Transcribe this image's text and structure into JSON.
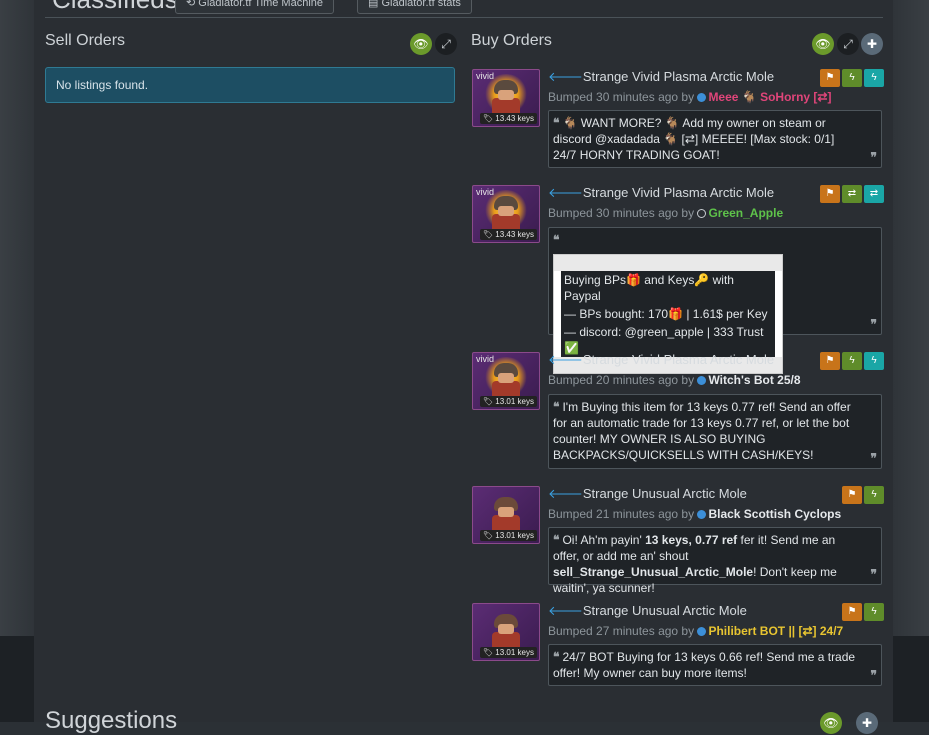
{
  "header": {
    "title": "Classifieds",
    "btn1": "Gladiator.tf Time Machine",
    "btn2": "Gladiator.tf stats"
  },
  "sell": {
    "title": "Sell Orders",
    "empty": "No listings found.",
    "icons": [
      "eye-icon",
      "expand-icon"
    ]
  },
  "buy": {
    "title": "Buy Orders",
    "icons": [
      "eye-icon",
      "expand-icon",
      "plus-icon"
    ]
  },
  "orders": [
    {
      "quality": "vivid",
      "price": "13.43 keys",
      "name": "Strange Vivid Plasma Arctic Mole",
      "bump": "Bumped 30 minutes ago by",
      "user": "Meee 🐐 SoHorny [⇄]",
      "userColor": "#e0457a",
      "status": "dot",
      "msg": "🐐 WANT MORE? 🐐 Add my owner on steam or discord @xadadada 🐐 [⇄] MEEEE! [Max stock: 0/1] 24/7 HORNY TRADING GOAT!",
      "actions": [
        "flag",
        "bolt",
        "bolt"
      ]
    },
    {
      "quality": "vivid",
      "price": "13.43 keys",
      "name": "Strange Vivid Plasma Arctic Mole",
      "bump": "Bumped 30 minutes ago by",
      "user": "Green_Apple",
      "userColor": "#5ec24a",
      "status": "ring",
      "msg_lines": [
        "Buying BPs🎁 and Keys🔑 with Paypal",
        "— BPs bought: 170🎁 | 1.61$ per Key",
        "— discord: @green_apple | 333 Trust ✅"
      ],
      "actions": [
        "flag",
        "swap",
        "swap"
      ]
    },
    {
      "quality": "vivid",
      "price": "13.01 keys",
      "name": "Strange Vivid Plasma Arctic Mole",
      "bump": "Bumped 20 minutes ago by",
      "user": "Witch's Bot 25/8",
      "userColor": "#e6e9ec",
      "status": "dot",
      "msg": "I'm Buying this item for 13 keys 0.77 ref! Send an offer for an automatic trade for 13 keys 0.77 ref, or let the bot counter! MY OWNER IS ALSO BUYING BACKPACKS/QUICKSELLS WITH CASH/KEYS!",
      "actions": [
        "flag",
        "bolt",
        "bolt"
      ]
    },
    {
      "quality": "",
      "price": "13.01 keys",
      "name": "Strange Unusual Arctic Mole",
      "bump": "Bumped 21 minutes ago by",
      "user": "Black Scottish Cyclops",
      "userColor": "#e6e9ec",
      "status": "dot",
      "msg_parts": [
        "Oi! Ah'm payin' ",
        "13 keys, 0.77 ref",
        " fer it! Send me an offer, or add me an' shout ",
        "sell_Strange_Unusual_Arctic_Mole",
        "! Don't keep me waitin', ya scunner!"
      ],
      "actions": [
        "flag",
        "bolt"
      ]
    },
    {
      "quality": "",
      "price": "13.01 keys",
      "name": "Strange Unusual Arctic Mole",
      "bump": "Bumped 27 minutes ago by",
      "user": "Philibert BOT || [⇄] 24/7",
      "userColor": "#e8c531",
      "status": "dot",
      "msg": "24/7 BOT Buying for 13 keys 0.66 ref! Send me a trade offer! My owner can buy more items!",
      "actions": [
        "flag",
        "bolt"
      ]
    }
  ],
  "footer": {
    "suggestions": "Suggestions"
  }
}
